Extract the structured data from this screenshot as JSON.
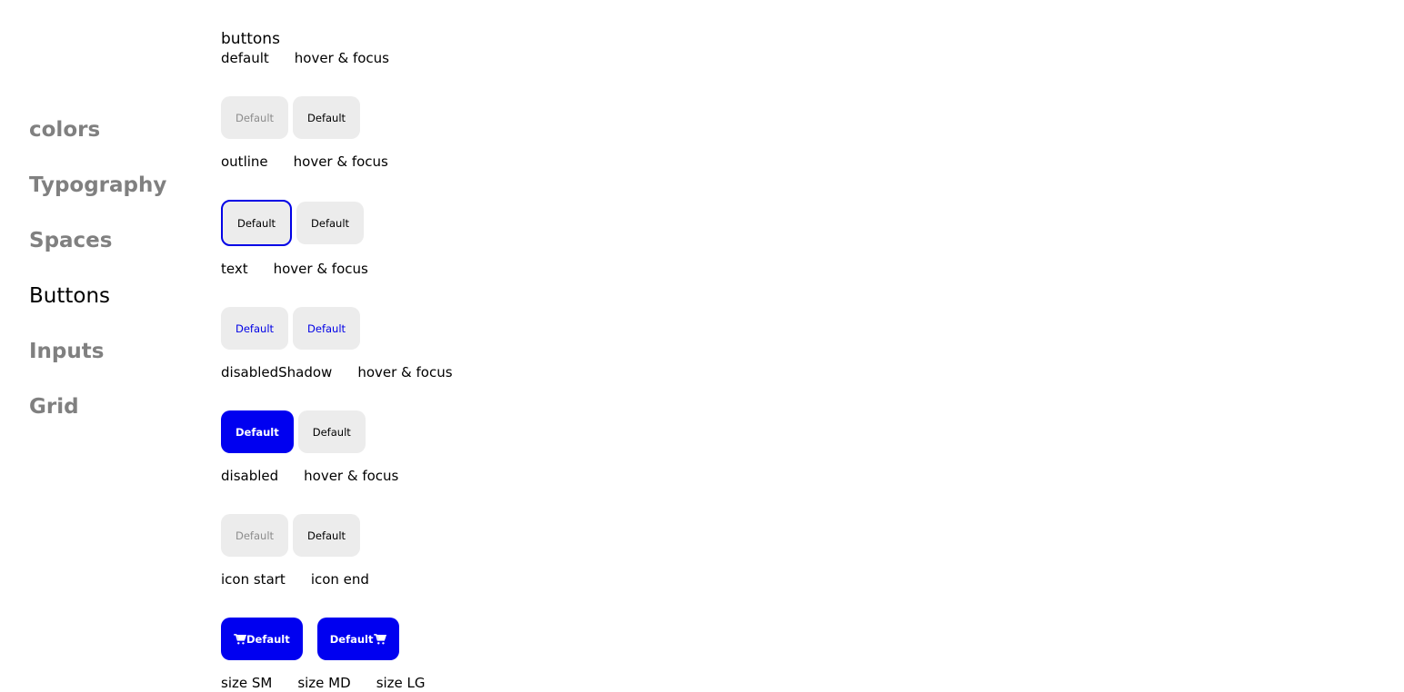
{
  "sidebar": {
    "items": [
      {
        "label": "colors"
      },
      {
        "label": "Typography"
      },
      {
        "label": "Spaces"
      },
      {
        "label": "Buttons"
      },
      {
        "label": "Inputs"
      },
      {
        "label": "Grid"
      }
    ],
    "active": "Buttons"
  },
  "main": {
    "title": "buttons",
    "sections": {
      "default": {
        "label": "default",
        "hover_label": "hover & focus",
        "buttons": [
          "Default",
          "Default"
        ]
      },
      "outline": {
        "label": "outline",
        "hover_label": "hover & focus",
        "buttons": [
          "Default",
          "Default"
        ]
      },
      "text": {
        "label": "text",
        "hover_label": "hover & focus",
        "buttons": [
          "Default",
          "Default"
        ]
      },
      "disabledShadow": {
        "label": "disabledShadow",
        "hover_label": "hover & focus",
        "buttons": [
          "Default",
          "Default"
        ]
      },
      "disabled": {
        "label": "disabled",
        "hover_label": "hover & focus",
        "buttons": [
          "Default",
          "Default"
        ]
      },
      "icon": {
        "start_label": "icon start",
        "end_label": "icon end",
        "buttons": [
          "Default",
          "Default"
        ],
        "icon": "cart-icon"
      },
      "size": {
        "labels": [
          "size SM",
          "size MD",
          "size LG"
        ]
      }
    }
  },
  "colors": {
    "primary": "#0000f0",
    "outline": "#0000e6",
    "button_bg": "#ececec",
    "muted_text": "#808080"
  }
}
